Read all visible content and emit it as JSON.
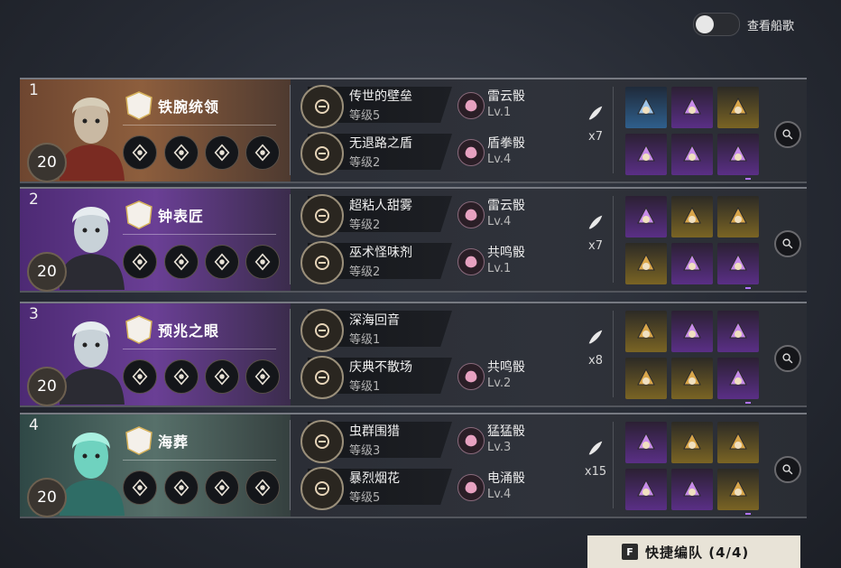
{
  "toggle": {
    "label": "查看船歌",
    "on": false
  },
  "teams": [
    {
      "number": "1",
      "level": "20",
      "name": "铁腕统领",
      "theme": "bronze",
      "items": [
        {
          "name": "传世的壁垒",
          "level": "等级5",
          "dice": "雷云骰",
          "dice_level": "Lv.1"
        },
        {
          "name": "无退路之盾",
          "level": "等级2",
          "dice": "盾拳骰",
          "dice_level": "Lv.4"
        }
      ],
      "piece_count": "x7",
      "gear": [
        "blue",
        "purple",
        "gold",
        "purple",
        "purple",
        "purple"
      ]
    },
    {
      "number": "2",
      "level": "20",
      "name": "钟表匠",
      "theme": "purple",
      "items": [
        {
          "name": "超粘人甜雾",
          "level": "等级2",
          "dice": "雷云骰",
          "dice_level": "Lv.4"
        },
        {
          "name": "巫术怪味剂",
          "level": "等级2",
          "dice": "共鸣骰",
          "dice_level": "Lv.1"
        }
      ],
      "piece_count": "x7",
      "gear": [
        "purple",
        "gold",
        "gold",
        "gold",
        "purple",
        "purple"
      ]
    },
    {
      "number": "3",
      "level": "20",
      "name": "预兆之眼",
      "theme": "purple",
      "items": [
        {
          "name": "深海回音",
          "level": "等级1",
          "dice": "",
          "dice_level": ""
        },
        {
          "name": "庆典不散场",
          "level": "等级1",
          "dice": "共鸣骰",
          "dice_level": "Lv.2"
        }
      ],
      "piece_count": "x8",
      "gear": [
        "gold",
        "purple",
        "purple",
        "gold",
        "gold",
        "purple"
      ]
    },
    {
      "number": "4",
      "level": "20",
      "name": "海葬",
      "theme": "teal",
      "items": [
        {
          "name": "虫群围猎",
          "level": "等级3",
          "dice": "猛猛骰",
          "dice_level": "Lv.3"
        },
        {
          "name": "暴烈烟花",
          "level": "等级5",
          "dice": "电涌骰",
          "dice_level": "Lv.4"
        }
      ],
      "piece_count": "x15",
      "gear": [
        "purple",
        "gold",
        "gold",
        "purple",
        "purple",
        "gold"
      ]
    }
  ],
  "quick_team": {
    "key": "F",
    "label": "快捷编队 (4/4)"
  },
  "colors": {
    "bronze": "#8a5b3c",
    "purple": "#6b3d94",
    "teal": "#4c6a64",
    "accent": "#b173ff"
  }
}
